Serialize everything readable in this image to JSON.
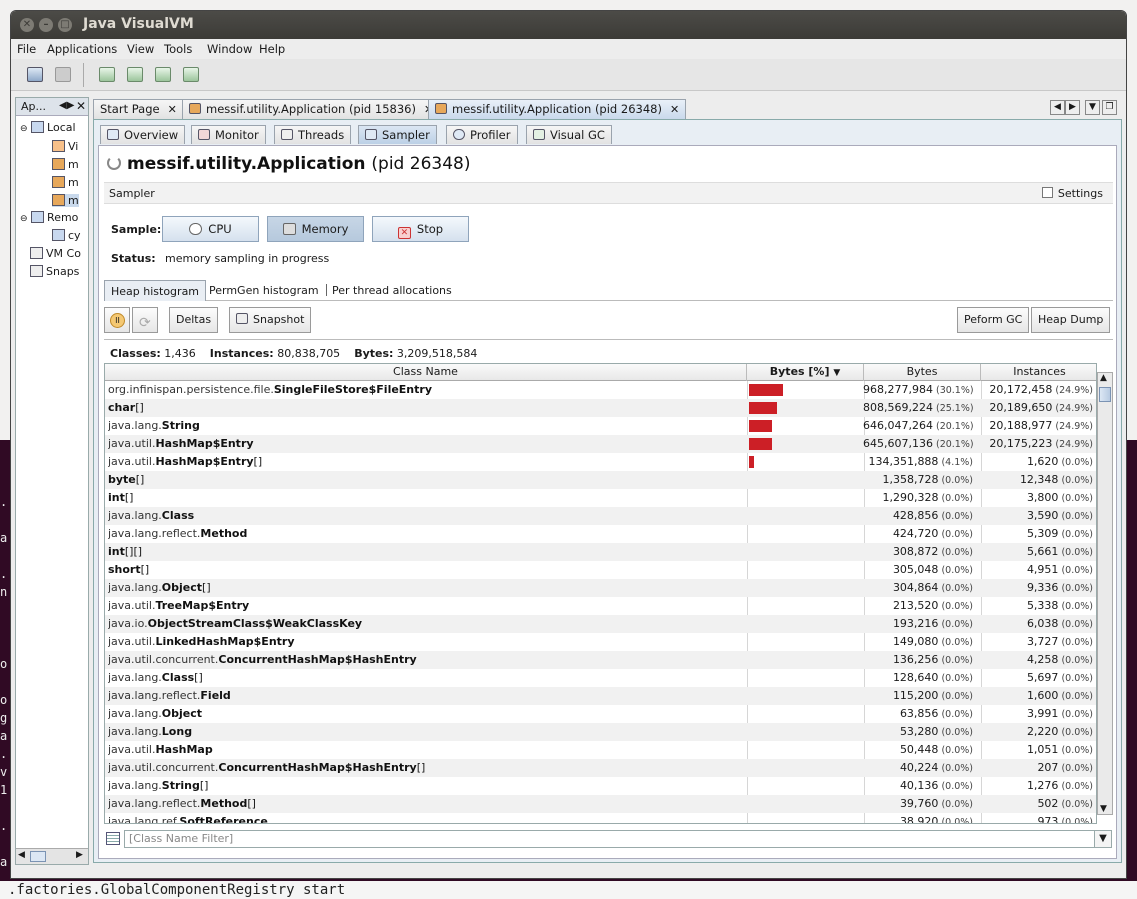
{
  "window": {
    "title": "Java VisualVM"
  },
  "menu": [
    "File",
    "Applications",
    "View",
    "Tools",
    "Window",
    "Help"
  ],
  "left_panel": {
    "tab_label": "Ap...",
    "tree": [
      "Local",
      "Vi",
      "m",
      "m",
      "m",
      "Remo",
      "cy",
      "VM Co",
      "Snaps"
    ]
  },
  "doc_tabs": [
    {
      "label": "Start Page"
    },
    {
      "label": "messif.utility.Application (pid 15836)"
    },
    {
      "label": "messif.utility.Application (pid 26348)"
    }
  ],
  "view_tabs": [
    "Overview",
    "Monitor",
    "Threads",
    "Sampler",
    "Profiler",
    "Visual GC"
  ],
  "app": {
    "name": "messif.utility.Application",
    "pid": "(pid 26348)"
  },
  "sampler": {
    "section_label": "Sampler",
    "settings_label": "Settings",
    "sample_label": "Sample:",
    "cpu_label": "CPU",
    "memory_label": "Memory",
    "stop_label": "Stop",
    "status_label": "Status:",
    "status_text": "memory sampling in progress"
  },
  "histogram_tabs": [
    "Heap histogram",
    "PermGen histogram",
    "Per thread allocations"
  ],
  "toolbar2": {
    "deltas": "Deltas",
    "snapshot": "Snapshot",
    "perform_gc": "Peform GC",
    "heap_dump": "Heap Dump"
  },
  "summary": {
    "classes_label": "Classes:",
    "classes": "1,436",
    "instances_label": "Instances:",
    "instances": "80,838,705",
    "bytes_label": "Bytes:",
    "bytes": "3,209,518,584"
  },
  "columns": {
    "class_name": "Class Name",
    "bytes_pct": "Bytes [%]",
    "bytes": "Bytes",
    "instances": "Instances"
  },
  "rows": [
    {
      "pkg": "org.infinispan.persistence.file.",
      "cls": "SingleFileStore$FileEntry",
      "suffix": "",
      "pct": 30.1,
      "bytes": "968,277,984",
      "bytes_pct": "(30.1%)",
      "instances": "20,172,458",
      "inst_pct": "(24.9%)"
    },
    {
      "pkg": "",
      "cls": "char",
      "suffix": "[]",
      "pct": 25.1,
      "bytes": "808,569,224",
      "bytes_pct": "(25.1%)",
      "instances": "20,189,650",
      "inst_pct": "(24.9%)"
    },
    {
      "pkg": "java.lang.",
      "cls": "String",
      "suffix": "",
      "pct": 20.1,
      "bytes": "646,047,264",
      "bytes_pct": "(20.1%)",
      "instances": "20,188,977",
      "inst_pct": "(24.9%)"
    },
    {
      "pkg": "java.util.",
      "cls": "HashMap$Entry",
      "suffix": "",
      "pct": 20.1,
      "bytes": "645,607,136",
      "bytes_pct": "(20.1%)",
      "instances": "20,175,223",
      "inst_pct": "(24.9%)"
    },
    {
      "pkg": "java.util.",
      "cls": "HashMap$Entry",
      "suffix": "[]",
      "pct": 4.1,
      "bytes": "134,351,888",
      "bytes_pct": "(4.1%)",
      "instances": "1,620",
      "inst_pct": "(0.0%)"
    },
    {
      "pkg": "",
      "cls": "byte",
      "suffix": "[]",
      "pct": 0,
      "bytes": "1,358,728",
      "bytes_pct": "(0.0%)",
      "instances": "12,348",
      "inst_pct": "(0.0%)"
    },
    {
      "pkg": "",
      "cls": "int",
      "suffix": "[]",
      "pct": 0,
      "bytes": "1,290,328",
      "bytes_pct": "(0.0%)",
      "instances": "3,800",
      "inst_pct": "(0.0%)"
    },
    {
      "pkg": "java.lang.",
      "cls": "Class",
      "suffix": "",
      "pct": 0,
      "bytes": "428,856",
      "bytes_pct": "(0.0%)",
      "instances": "3,590",
      "inst_pct": "(0.0%)"
    },
    {
      "pkg": "java.lang.reflect.",
      "cls": "Method",
      "suffix": "",
      "pct": 0,
      "bytes": "424,720",
      "bytes_pct": "(0.0%)",
      "instances": "5,309",
      "inst_pct": "(0.0%)"
    },
    {
      "pkg": "",
      "cls": "int",
      "suffix": "[][]",
      "pct": 0,
      "bytes": "308,872",
      "bytes_pct": "(0.0%)",
      "instances": "5,661",
      "inst_pct": "(0.0%)"
    },
    {
      "pkg": "",
      "cls": "short",
      "suffix": "[]",
      "pct": 0,
      "bytes": "305,048",
      "bytes_pct": "(0.0%)",
      "instances": "4,951",
      "inst_pct": "(0.0%)"
    },
    {
      "pkg": "java.lang.",
      "cls": "Object",
      "suffix": "[]",
      "pct": 0,
      "bytes": "304,864",
      "bytes_pct": "(0.0%)",
      "instances": "9,336",
      "inst_pct": "(0.0%)"
    },
    {
      "pkg": "java.util.",
      "cls": "TreeMap$Entry",
      "suffix": "",
      "pct": 0,
      "bytes": "213,520",
      "bytes_pct": "(0.0%)",
      "instances": "5,338",
      "inst_pct": "(0.0%)"
    },
    {
      "pkg": "java.io.",
      "cls": "ObjectStreamClass$WeakClassKey",
      "suffix": "",
      "pct": 0,
      "bytes": "193,216",
      "bytes_pct": "(0.0%)",
      "instances": "6,038",
      "inst_pct": "(0.0%)"
    },
    {
      "pkg": "java.util.",
      "cls": "LinkedHashMap$Entry",
      "suffix": "",
      "pct": 0,
      "bytes": "149,080",
      "bytes_pct": "(0.0%)",
      "instances": "3,727",
      "inst_pct": "(0.0%)"
    },
    {
      "pkg": "java.util.concurrent.",
      "cls": "ConcurrentHashMap$HashEntry",
      "suffix": "",
      "pct": 0,
      "bytes": "136,256",
      "bytes_pct": "(0.0%)",
      "instances": "4,258",
      "inst_pct": "(0.0%)"
    },
    {
      "pkg": "java.lang.",
      "cls": "Class",
      "suffix": "[]",
      "pct": 0,
      "bytes": "128,640",
      "bytes_pct": "(0.0%)",
      "instances": "5,697",
      "inst_pct": "(0.0%)"
    },
    {
      "pkg": "java.lang.reflect.",
      "cls": "Field",
      "suffix": "",
      "pct": 0,
      "bytes": "115,200",
      "bytes_pct": "(0.0%)",
      "instances": "1,600",
      "inst_pct": "(0.0%)"
    },
    {
      "pkg": "java.lang.",
      "cls": "Object",
      "suffix": "",
      "pct": 0,
      "bytes": "63,856",
      "bytes_pct": "(0.0%)",
      "instances": "3,991",
      "inst_pct": "(0.0%)"
    },
    {
      "pkg": "java.lang.",
      "cls": "Long",
      "suffix": "",
      "pct": 0,
      "bytes": "53,280",
      "bytes_pct": "(0.0%)",
      "instances": "2,220",
      "inst_pct": "(0.0%)"
    },
    {
      "pkg": "java.util.",
      "cls": "HashMap",
      "suffix": "",
      "pct": 0,
      "bytes": "50,448",
      "bytes_pct": "(0.0%)",
      "instances": "1,051",
      "inst_pct": "(0.0%)"
    },
    {
      "pkg": "java.util.concurrent.",
      "cls": "ConcurrentHashMap$HashEntry",
      "suffix": "[]",
      "pct": 0,
      "bytes": "40,224",
      "bytes_pct": "(0.0%)",
      "instances": "207",
      "inst_pct": "(0.0%)"
    },
    {
      "pkg": "java.lang.",
      "cls": "String",
      "suffix": "[]",
      "pct": 0,
      "bytes": "40,136",
      "bytes_pct": "(0.0%)",
      "instances": "1,276",
      "inst_pct": "(0.0%)"
    },
    {
      "pkg": "java.lang.reflect.",
      "cls": "Method",
      "suffix": "[]",
      "pct": 0,
      "bytes": "39,760",
      "bytes_pct": "(0.0%)",
      "instances": "502",
      "inst_pct": "(0.0%)"
    },
    {
      "pkg": "java.lang.ref.",
      "cls": "SoftReference",
      "suffix": "",
      "pct": 0,
      "bytes": "38,920",
      "bytes_pct": "(0.0%)",
      "instances": "973",
      "inst_pct": "(0.0%)"
    }
  ],
  "filter": {
    "placeholder": "[Class Name Filter]"
  },
  "terminal": {
    "bottom_line": ".factories.GlobalComponentRegistry start",
    "side_chars": [
      ".",
      "a",
      ".",
      "n",
      "o",
      "o",
      "g",
      "a",
      ".",
      "v",
      "1",
      ".",
      "a"
    ]
  },
  "colors": {
    "bar": "#cc1f26",
    "accent": "#bcd0e6"
  }
}
